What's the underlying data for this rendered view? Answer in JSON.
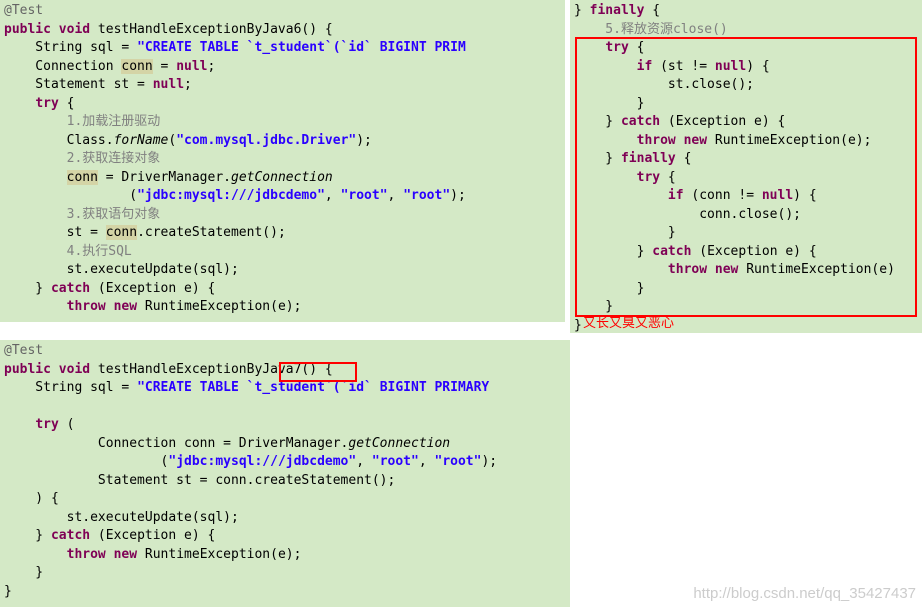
{
  "pane1": {
    "l0": "@Test",
    "l1a": "public void",
    "l1b": " testHandleExceptionByJava6() {",
    "l2a": "    String sql = ",
    "l2b": "\"CREATE TABLE `t_student`(`id` BIGINT PRIM",
    "l3a": "    Connection ",
    "l3b": "conn",
    "l3c": " = ",
    "l3d": "null",
    "l3e": ";",
    "l4a": "    Statement st = ",
    "l4b": "null",
    "l4c": ";",
    "l5a": "    ",
    "l5b": "try",
    "l5c": " {",
    "l6": "        1.加载注册驱动",
    "l7a": "        Class.",
    "l7b": "forName",
    "l7c": "(",
    "l7d": "\"com.mysql.jdbc.Driver\"",
    "l7e": ");",
    "l8": "        2.获取连接对象",
    "l9a": "        ",
    "l9b": "conn",
    "l9c": " = DriverManager.",
    "l9d": "getConnection",
    "l10a": "                (",
    "l10b": "\"jdbc:mysql:///jdbcdemo\"",
    "l10c": ", ",
    "l10d": "\"root\"",
    "l10e": ", ",
    "l10f": "\"root\"",
    "l10g": ");",
    "l11": "        3.获取语句对象",
    "l12a": "        st = ",
    "l12b": "conn",
    "l12c": ".createStatement();",
    "l13": "        4.执行SQL",
    "l14": "        st.executeUpdate(sql);",
    "l15a": "    } ",
    "l15b": "catch",
    "l15c": " (Exception e) {",
    "l16a": "        ",
    "l16b": "throw new",
    "l16c": " RuntimeException(e);"
  },
  "pane2": {
    "l0a": "} ",
    "l0b": "finally",
    "l0c": " {",
    "l1": "    5.释放资源close()",
    "l2a": "    ",
    "l2b": "try",
    "l2c": " {",
    "l3a": "        ",
    "l3b": "if",
    "l3c": " (st != ",
    "l3d": "null",
    "l3e": ") {",
    "l4": "            st.close();",
    "l5": "        }",
    "l6a": "    } ",
    "l6b": "catch",
    "l6c": " (Exception e) {",
    "l7a": "        ",
    "l7b": "throw new",
    "l7c": " RuntimeException(e);",
    "l8a": "    } ",
    "l8b": "finally",
    "l8c": " {",
    "l9a": "        ",
    "l9b": "try",
    "l9c": " {",
    "l10a": "            ",
    "l10b": "if",
    "l10c": " (conn != ",
    "l10d": "null",
    "l10e": ") {",
    "l11": "                conn.close();",
    "l12": "            }",
    "l13a": "        } ",
    "l13b": "catch",
    "l13c": " (Exception e) {",
    "l14a": "            ",
    "l14b": "throw new",
    "l14c": " RuntimeException(e)",
    "l15": "        }",
    "l16": "    }",
    "l17": "}"
  },
  "pane3": {
    "l0": "@Test",
    "l1a": "public void",
    "l1b": " testHandleExceptionByJava7() {",
    "l2a": "    String sql = ",
    "l2b": "\"CREATE TABLE `t_student`(`id` BIGINT PRIMARY",
    "l3": " ",
    "l4a": "    ",
    "l4b": "try",
    "l4c": " (",
    "l5a": "            Connection conn = DriverManager.",
    "l5b": "getConnection",
    "l6a": "                    (",
    "l6b": "\"jdbc:mysql:///jdbcdemo\"",
    "l6c": ", ",
    "l6d": "\"root\"",
    "l6e": ", ",
    "l6f": "\"root\"",
    "l6g": ");",
    "l7": "            Statement st = conn.createStatement();",
    "l8": "    ) {",
    "l9": "        st.executeUpdate(sql);",
    "l10a": "    } ",
    "l10b": "catch",
    "l10c": " (Exception e) {",
    "l11a": "        ",
    "l11b": "throw new",
    "l11c": " RuntimeException(e);",
    "l12": "    }",
    "l13": "}"
  },
  "comment_red": "又长又臭又恶心",
  "watermark": "http://blog.csdn.net/qq_35427437"
}
